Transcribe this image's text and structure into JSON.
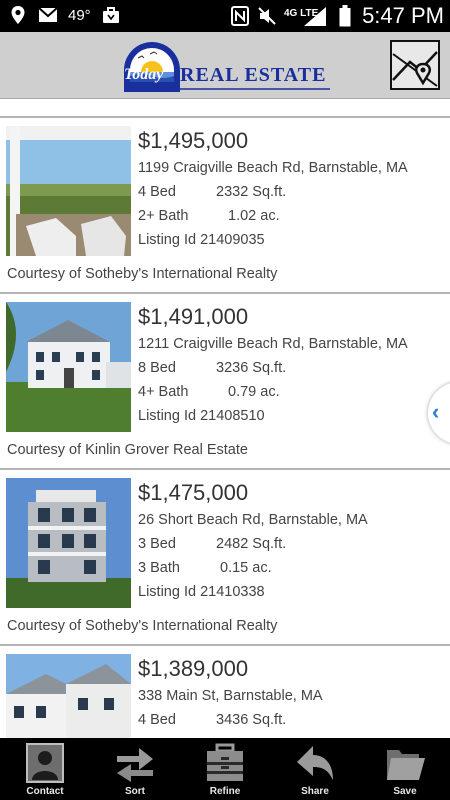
{
  "status_bar": {
    "temperature": "49°",
    "network": "4G LTE",
    "time": "5:47 PM"
  },
  "header": {
    "logo_today": "Today",
    "logo_text": "REAL ESTATE",
    "map_button_icon": "map-pin-icon"
  },
  "listings": [
    {
      "price": "$1,495,000",
      "address": "1199 Craigville Beach Rd,  Barnstable, MA",
      "beds": "4 Bed",
      "sqft": "2332 Sq.ft.",
      "baths": "2+ Bath",
      "acres": "1.02 ac.",
      "listing_id": "Listing Id 21409035",
      "courtesy": "Courtesy of Sotheby's International Realty"
    },
    {
      "price": "$1,491,000",
      "address": "1211 Craigville Beach Rd,  Barnstable, MA",
      "beds": "8 Bed",
      "sqft": "3236 Sq.ft.",
      "baths": "4+ Bath",
      "acres": "0.79 ac.",
      "listing_id": "Listing Id 21408510",
      "courtesy": "Courtesy of Kinlin Grover Real Estate"
    },
    {
      "price": "$1,475,000",
      "address": "26 Short Beach Rd,  Barnstable, MA",
      "beds": "3 Bed",
      "sqft": "2482 Sq.ft.",
      "baths": "3 Bath",
      "acres": "0.15 ac.",
      "listing_id": "Listing Id 21410338",
      "courtesy": "Courtesy of Sotheby's International Realty"
    },
    {
      "price": "$1,389,000",
      "address": "338 Main St,  Barnstable, MA",
      "beds": "4 Bed",
      "sqft": "3436 Sq.ft."
    }
  ],
  "toolbar": {
    "contact": "Contact",
    "sort": "Sort",
    "refine": "Refine",
    "share": "Share",
    "save": "Save"
  }
}
